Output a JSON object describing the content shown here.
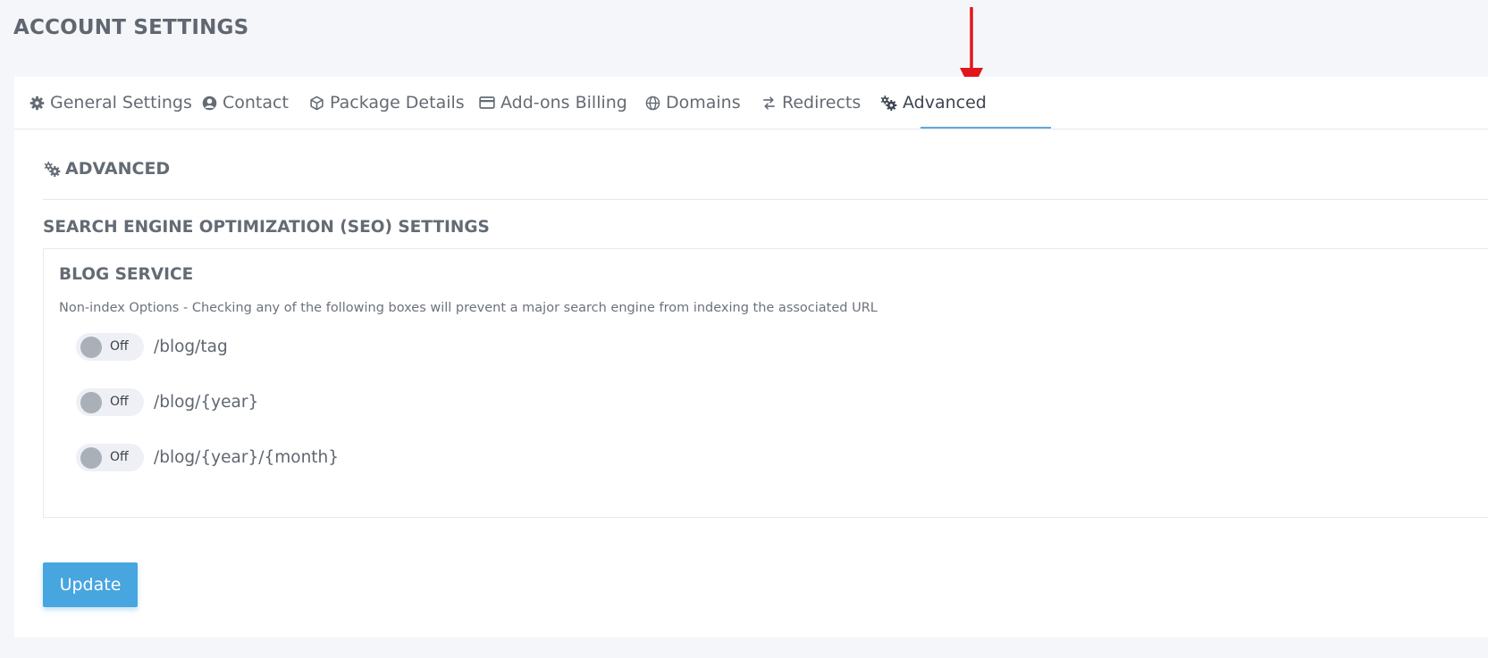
{
  "page": {
    "title": "ACCOUNT SETTINGS"
  },
  "tabs": [
    {
      "label": "General Settings",
      "icon": "gear-icon"
    },
    {
      "label": "Contact",
      "icon": "user-circle-icon"
    },
    {
      "label": "Package Details",
      "icon": "box-icon"
    },
    {
      "label": "Add-ons Billing",
      "icon": "credit-card-icon"
    },
    {
      "label": "Domains",
      "icon": "globe-icon"
    },
    {
      "label": "Redirects",
      "icon": "redirect-arrows-icon"
    },
    {
      "label": "Advanced",
      "icon": "gears-icon",
      "active": true
    }
  ],
  "section": {
    "heading": "ADVANCED",
    "icon": "gears-icon"
  },
  "seo": {
    "title": "SEARCH ENGINE OPTIMIZATION (SEO) SETTINGS",
    "blog": {
      "title": "BLOG SERVICE",
      "description": "Non-index Options - Checking any of the following boxes will prevent a major search engine from indexing the associated URL",
      "options": [
        {
          "path": "/blog/tag",
          "state": "Off"
        },
        {
          "path": "/blog/{year}",
          "state": "Off"
        },
        {
          "path": "/blog/{year}/{month}",
          "state": "Off"
        }
      ]
    }
  },
  "actions": {
    "update_label": "Update"
  },
  "colors": {
    "accent": "#47a5e0",
    "annotation_arrow": "#e0161c",
    "tab_underline": "#5ea8dd"
  }
}
